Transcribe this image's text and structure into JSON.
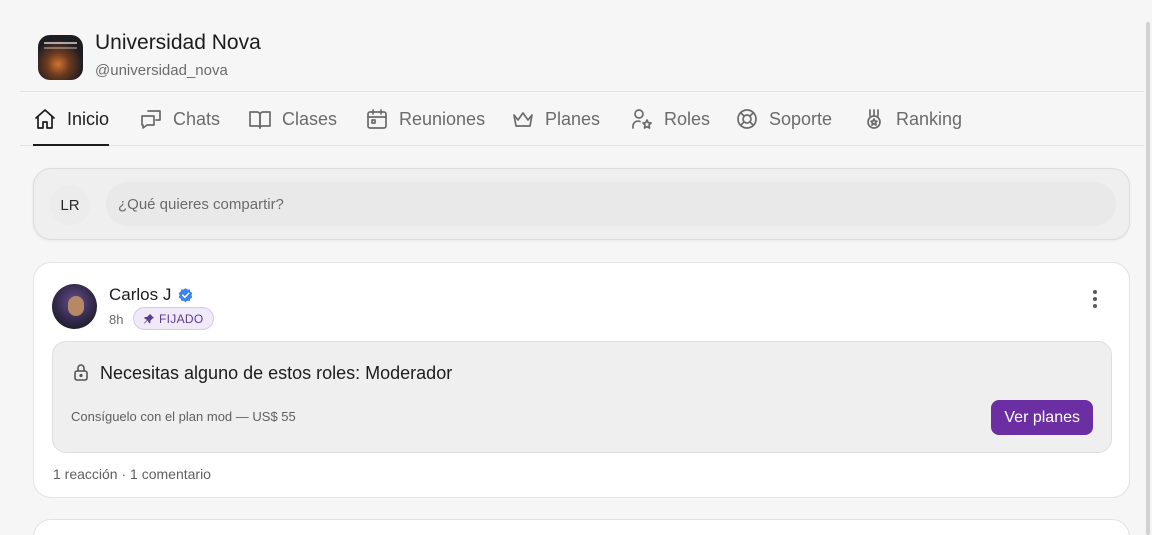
{
  "community": {
    "name": "Universidad Nova",
    "handle": "@universidad_nova"
  },
  "tabs": [
    {
      "label": "Inicio",
      "icon": "home-icon",
      "active": true
    },
    {
      "label": "Chats",
      "icon": "chat-bubbles-icon",
      "active": false
    },
    {
      "label": "Clases",
      "icon": "open-book-icon",
      "active": false
    },
    {
      "label": "Reuniones",
      "icon": "calendar-icon",
      "active": false
    },
    {
      "label": "Planes",
      "icon": "crown-icon",
      "active": false
    },
    {
      "label": "Roles",
      "icon": "user-star-icon",
      "active": false
    },
    {
      "label": "Soporte",
      "icon": "lifebuoy-icon",
      "active": false
    },
    {
      "label": "Ranking",
      "icon": "medal-icon",
      "active": false
    }
  ],
  "composer": {
    "avatar_initials": "LR",
    "placeholder": "¿Qué quieres compartir?"
  },
  "post": {
    "author": "Carlos J",
    "verified": true,
    "time": "8h",
    "pinned_label": "FIJADO",
    "locked": {
      "title": "Necesitas alguno de estos roles: Moderador",
      "description": "Consíguelo con el plan mod — US$ 55",
      "button_label": "Ver planes"
    },
    "stats": "1 reacción · 1 comentario"
  },
  "colors": {
    "accent": "#6b2fa3",
    "verified": "#3b82f6",
    "badge_bg": "#efe9f8"
  }
}
